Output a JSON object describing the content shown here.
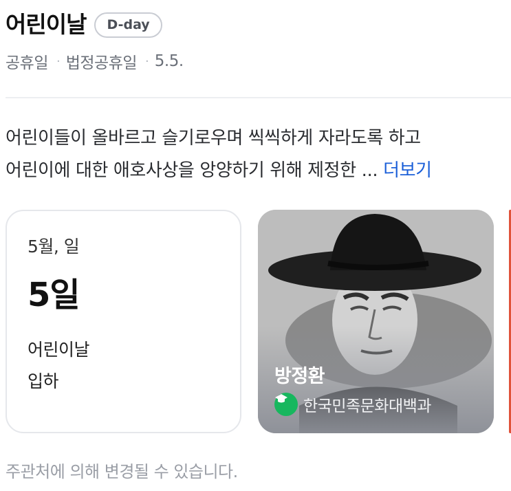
{
  "header": {
    "title": "어린이날",
    "dday_label": "D-day",
    "meta": [
      "공휴일",
      "법정공휴일",
      "5.5."
    ]
  },
  "description": {
    "line1": "어린이들이 올바르고 슬기로우며 씩씩하게 자라도록 하고",
    "line2": "어린이에 대한 애호사상을 앙양하기 위해 제정한 ...",
    "more_label": "더보기"
  },
  "date_card": {
    "small": "5월, 일",
    "big": "5일",
    "line1": "어린이날",
    "line2": "입하"
  },
  "photo_card": {
    "name": "방정환",
    "source": "한국민족문화대백과",
    "source_icon": "graduation-cap-icon",
    "source_icon_color": "#17b75e"
  },
  "footer": "주관처에 의해 변경될 수 있습니다."
}
